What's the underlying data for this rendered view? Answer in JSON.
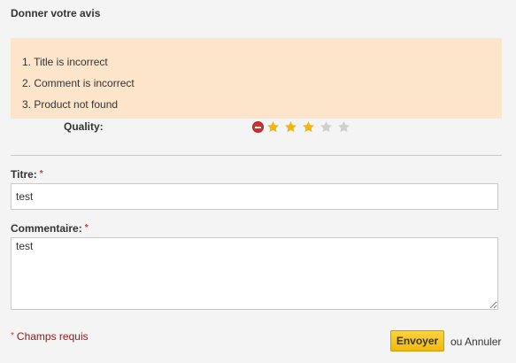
{
  "page": {
    "title": "Donner votre avis"
  },
  "errors": [
    {
      "text": "1. Title is incorrect"
    },
    {
      "text": "2. Comment is incorrect"
    },
    {
      "text": "3. Product not found"
    }
  ],
  "rating": {
    "label": "Quality:",
    "value": 3,
    "max": 5,
    "filled_color": "#f5b50a",
    "empty_color": "#cfcfcf",
    "cancel_icon": "cancel-icon"
  },
  "form": {
    "title_label": "Titre:",
    "title_value": "test",
    "comment_label": "Commentaire:",
    "comment_value": "test",
    "required_marker": "*",
    "required_note": "Champs requis"
  },
  "actions": {
    "submit_label": "Envoyer",
    "or_text": "ou",
    "cancel_label": "Annuler"
  },
  "colors": {
    "background": "#f4f4f4",
    "error_background": "#fde5cc",
    "button_accent": "#f7c81e",
    "required_color": "#c0392b"
  }
}
